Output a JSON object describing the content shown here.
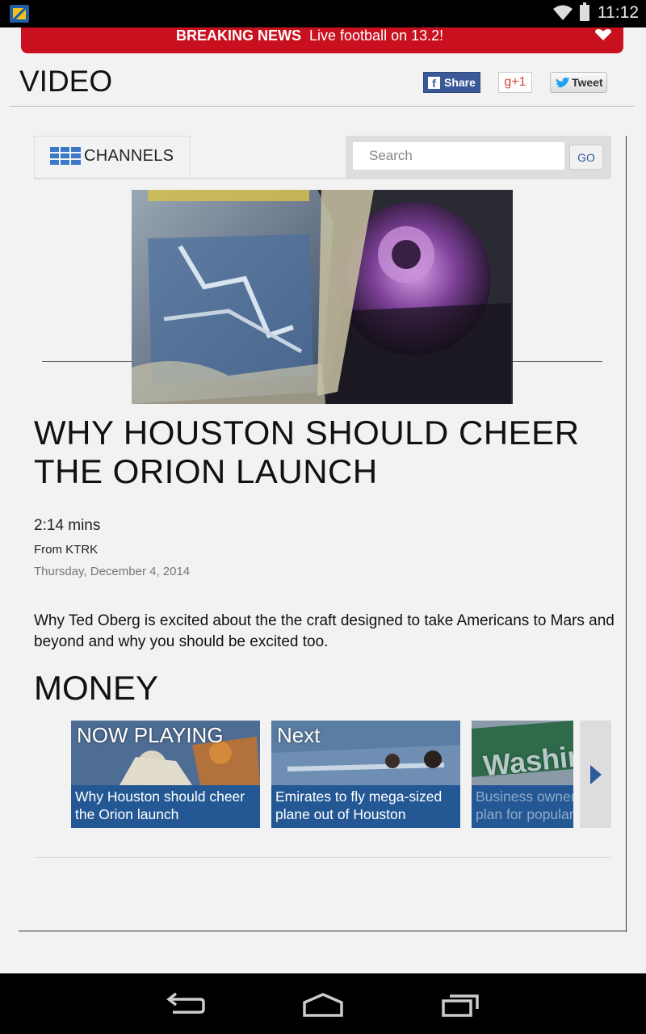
{
  "status_bar": {
    "time": "11:12"
  },
  "breaking": {
    "label": "BREAKING NEWS",
    "text": "Live football on 13.2!"
  },
  "header": {
    "title": "VIDEO",
    "share_label": "Share",
    "gplus_label": "g+1",
    "tweet_label": "Tweet"
  },
  "channels": {
    "label": "CHANNELS"
  },
  "search": {
    "placeholder": "Search",
    "go_label": "GO"
  },
  "video": {
    "title": "WHY HOUSTON SHOULD CHEER THE ORION LAUNCH",
    "duration": "2:14 mins",
    "source": "From KTRK",
    "date": "Thursday, December 4, 2014",
    "description": "Why Ted Oberg is excited about the the craft designed to take Americans to Mars and beyond and why you should be excited too."
  },
  "section": {
    "title": "MONEY"
  },
  "carousel": {
    "items": [
      {
        "status": "NOW PLAYING",
        "caption_line1": "Why Houston should cheer",
        "caption_line2": "the Orion launch"
      },
      {
        "status": "Next",
        "caption_line1": "Emirates to fly mega-sized",
        "caption_line2": "plane out of Houston"
      },
      {
        "status": "Washington",
        "caption_line1": "Business owner",
        "caption_line2": "plan for popular"
      }
    ]
  },
  "colors": {
    "breaking_red": "#c8101f",
    "caption_blue": "#245895",
    "facebook_blue": "#3b5998"
  }
}
